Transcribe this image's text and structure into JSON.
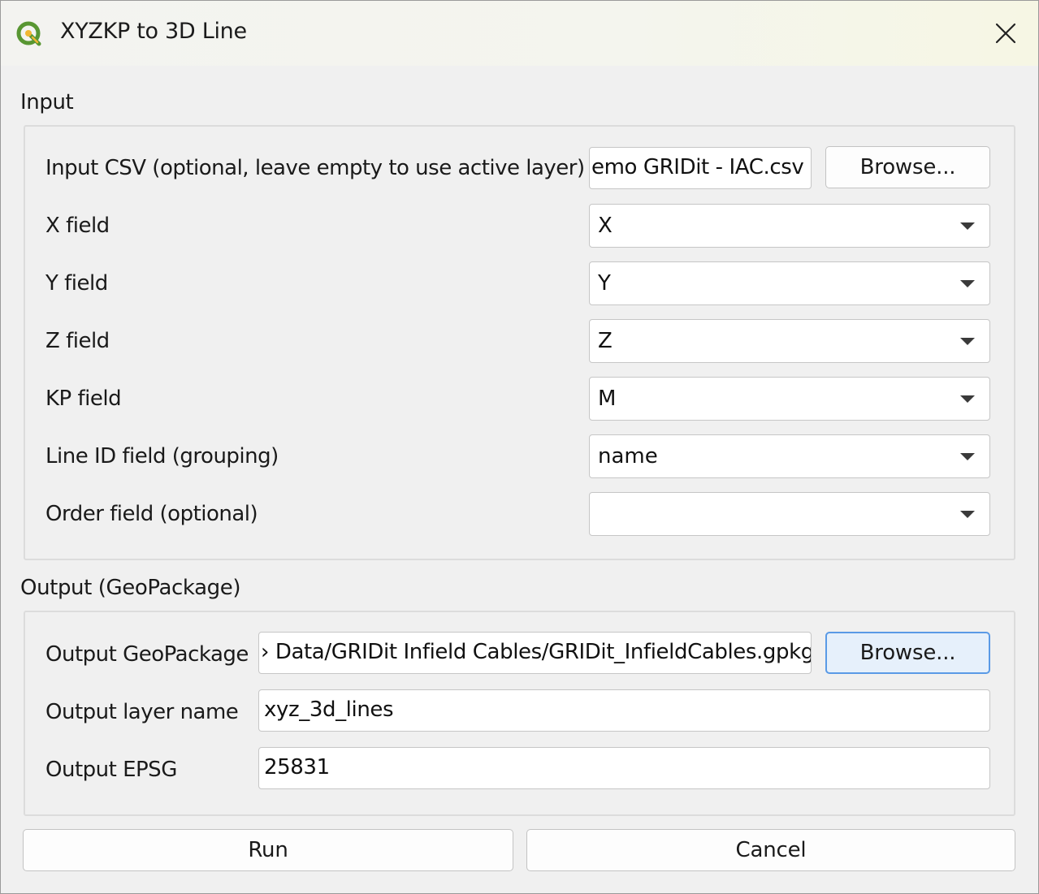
{
  "window": {
    "title": "XYZKP to 3D Line",
    "close_glyph": "✕",
    "app_icon": "qgis-logo-icon",
    "brand_color": "#589632",
    "accent_color": "#f0b632"
  },
  "input_group": {
    "title": "Input",
    "csv_label": "Input CSV (optional, leave empty to use active layer)",
    "csv_value": "emo GRIDit - IAC.csv",
    "browse_label": "Browse...",
    "x_label": "X field",
    "x_value": "X",
    "y_label": "Y field",
    "y_value": "Y",
    "z_label": "Z field",
    "z_value": "Z",
    "kp_label": "KP field",
    "kp_value": "M",
    "lineid_label": "Line ID field (grouping)",
    "lineid_value": "name",
    "order_label": "Order field (optional)",
    "order_value": ""
  },
  "output_group": {
    "title": "Output (GeoPackage)",
    "gpkg_label": "Output GeoPackage",
    "gpkg_value": "› Data/GRIDit Infield Cables/GRIDit_InfieldCables.gpkg",
    "browse_label": "Browse...",
    "layer_label": "Output layer name",
    "layer_value": "xyz_3d_lines",
    "epsg_label": "Output EPSG",
    "epsg_value": "25831"
  },
  "actions": {
    "run_label": "Run",
    "cancel_label": "Cancel"
  }
}
